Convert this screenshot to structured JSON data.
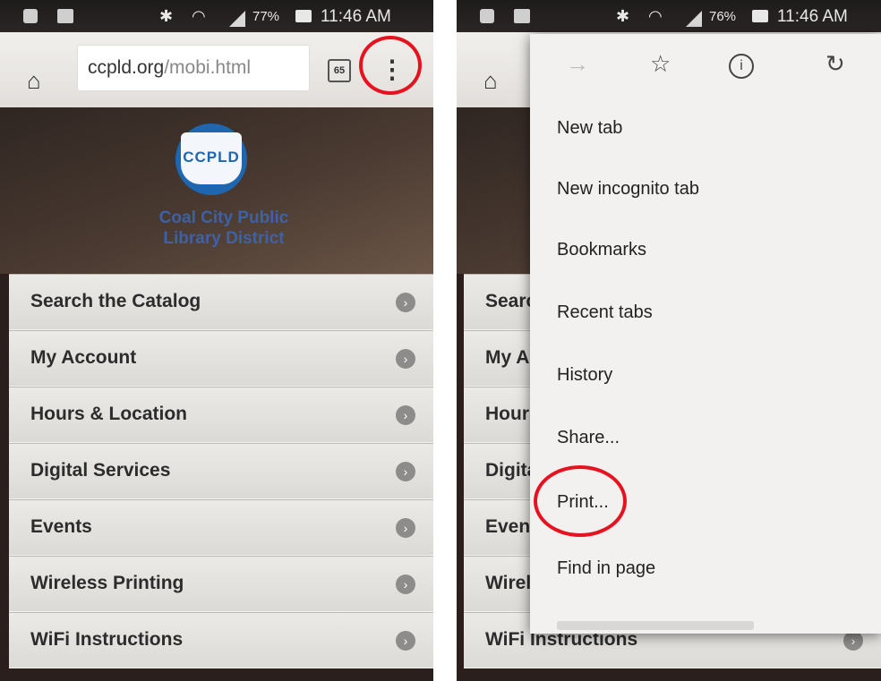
{
  "left": {
    "status_bar": {
      "battery": "77%",
      "time": "11:46 AM"
    },
    "url_bar": {
      "domain": "ccpld.org",
      "path": "/mobi.html",
      "tab_count": "65"
    },
    "hero": {
      "logo_text": "CCPLD",
      "title_line1": "Coal City Public",
      "title_line2": "Library District"
    },
    "menu": [
      {
        "label": "Search the Catalog"
      },
      {
        "label": "My Account"
      },
      {
        "label": "Hours & Location"
      },
      {
        "label": "Digital Services"
      },
      {
        "label": "Events"
      },
      {
        "label": "Wireless Printing"
      },
      {
        "label": "WiFi Instructions"
      }
    ]
  },
  "right": {
    "status_bar": {
      "battery": "76%",
      "time": "11:46 AM"
    },
    "background_menu": [
      {
        "label": "Searc"
      },
      {
        "label": "My Ac"
      },
      {
        "label": "Hours"
      },
      {
        "label": "Digita"
      },
      {
        "label": "Event"
      },
      {
        "label": "Wirele"
      },
      {
        "label": "WiFi Instructions"
      }
    ],
    "dropdown": {
      "icons": [
        "forward-icon",
        "star-icon",
        "info-icon",
        "reload-icon"
      ],
      "items": [
        {
          "label": "New tab"
        },
        {
          "label": "New incognito tab"
        },
        {
          "label": "Bookmarks"
        },
        {
          "label": "Recent tabs"
        },
        {
          "label": "History"
        },
        {
          "label": "Share..."
        },
        {
          "label": "Print..."
        },
        {
          "label": "Find in page"
        }
      ]
    }
  },
  "colors": {
    "highlight": "#e5121f",
    "brand_blue": "#1e66b0"
  }
}
